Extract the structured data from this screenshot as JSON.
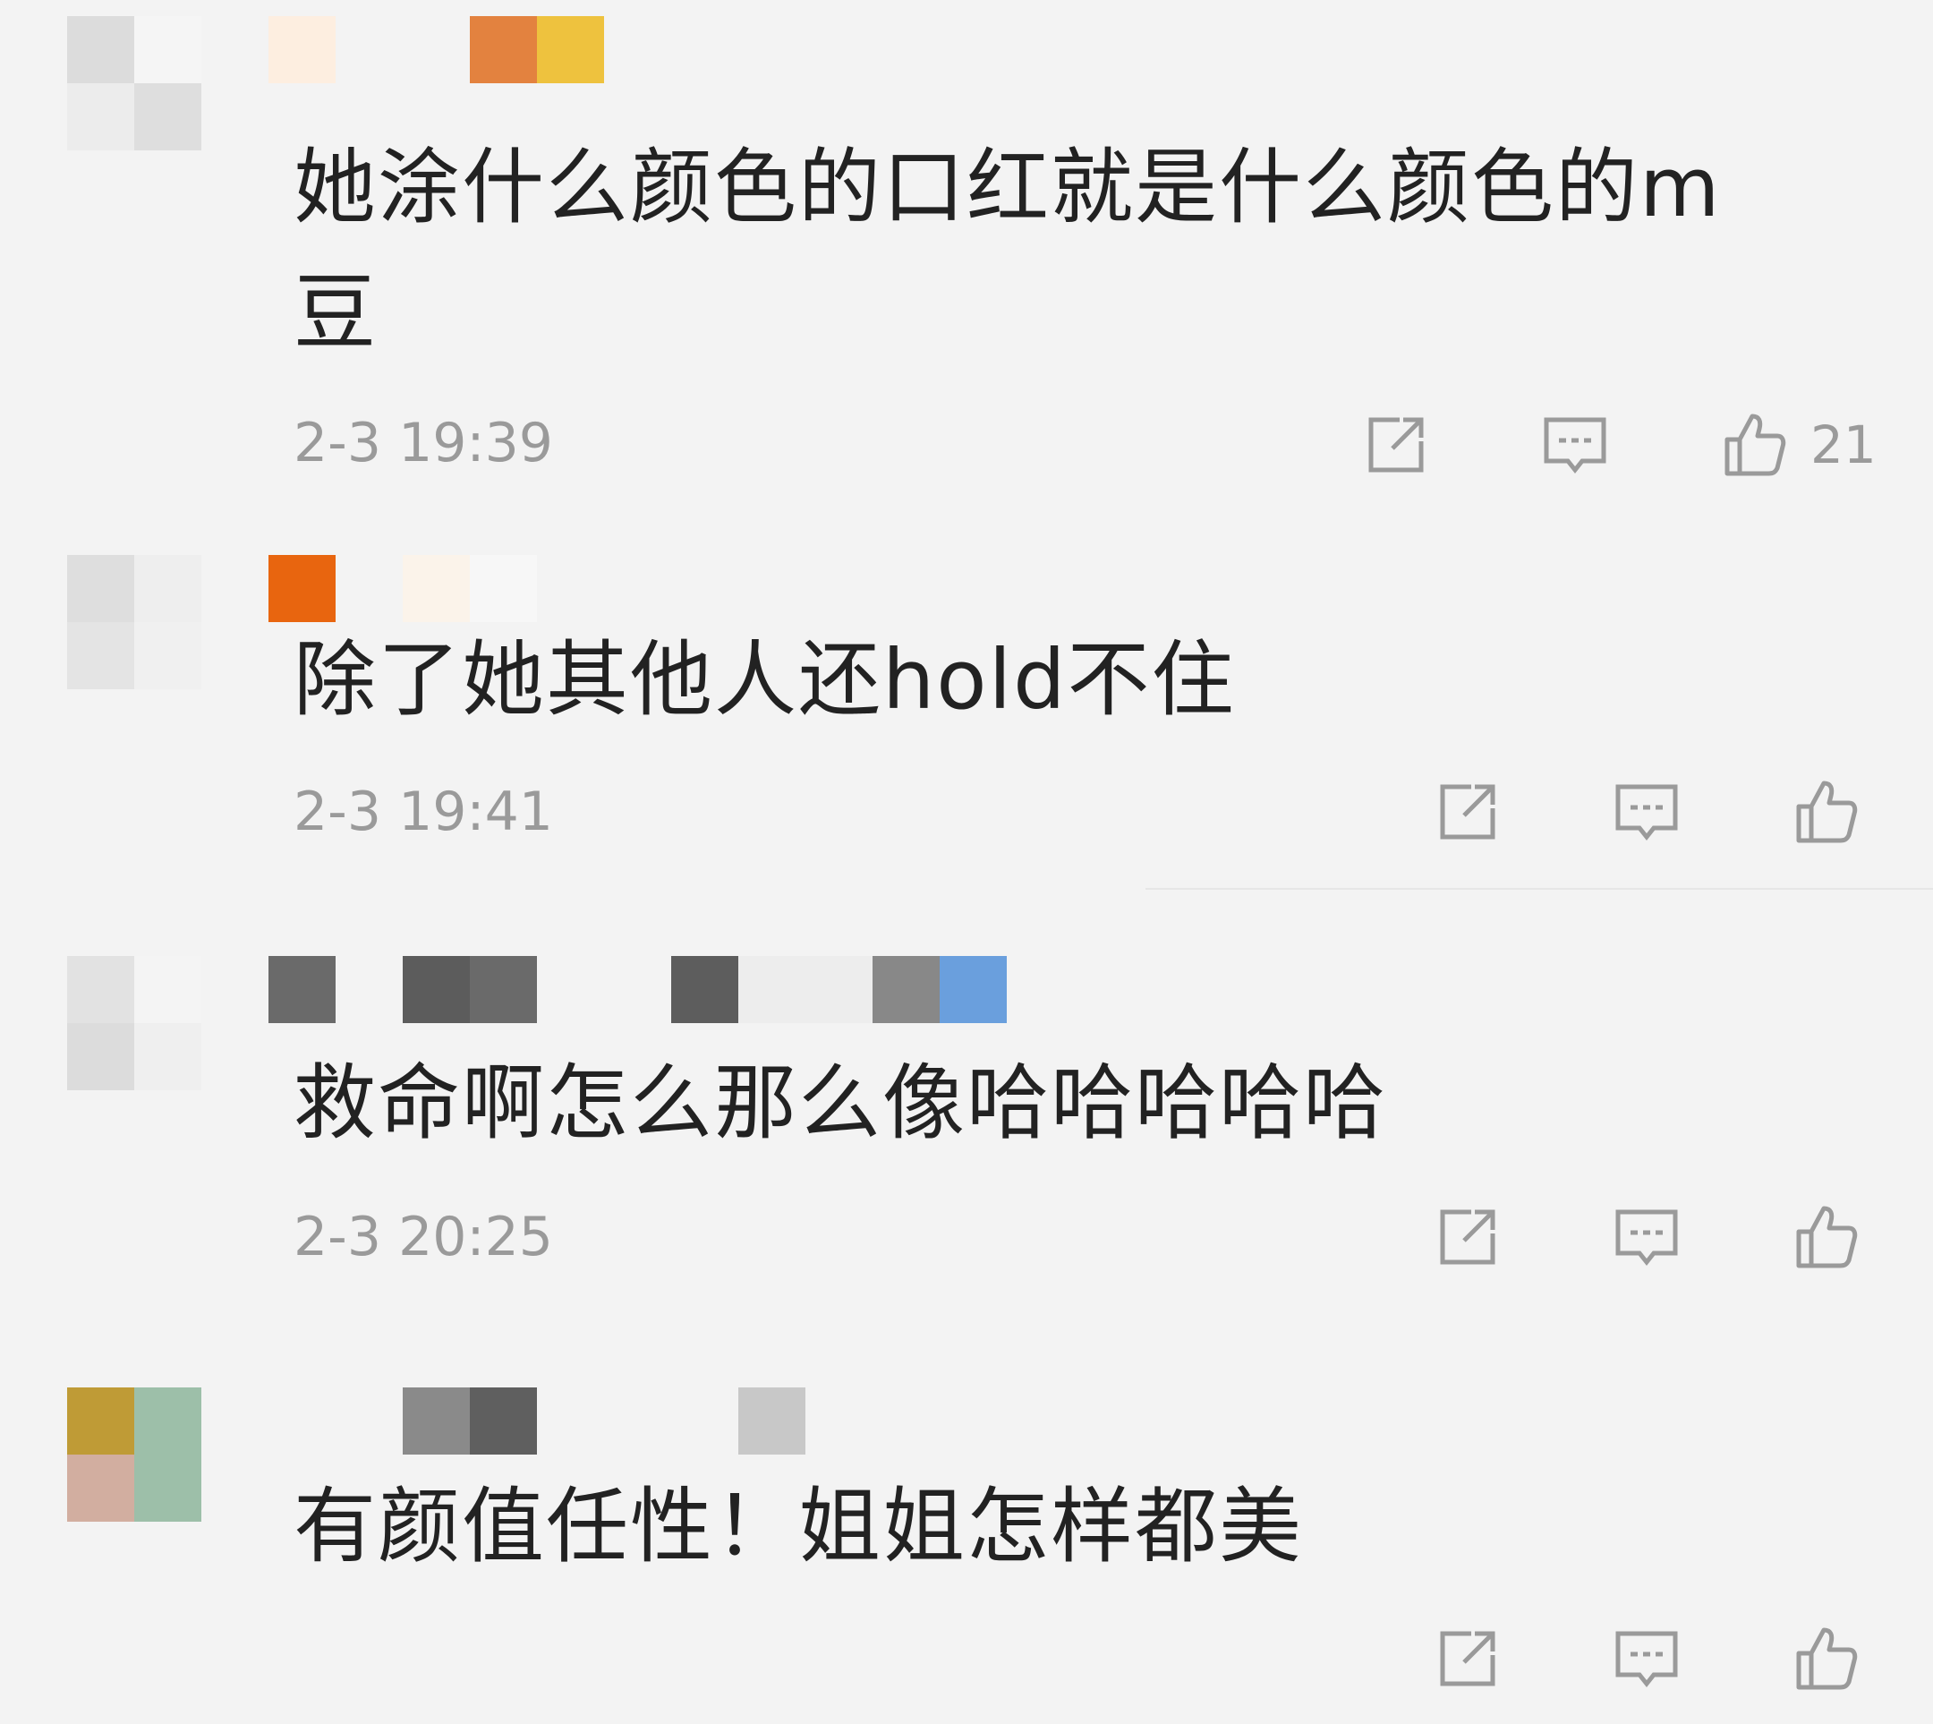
{
  "comments": [
    {
      "text": "她涂什么颜色的口红就是什么颜色的m\n豆",
      "time": "2-3 19:39",
      "likes": "21",
      "avatar_colors": [
        "#dcdcdc",
        "#f5f5f5",
        "#ececec",
        "#dedede"
      ],
      "username_colors": [
        "#fdeee0",
        "#f7f7f7",
        "#f4f4f4",
        "#e3823f",
        "#eec23e"
      ]
    },
    {
      "text": "除了她其他人还hold不住",
      "time": "2-3 19:41",
      "likes": "",
      "avatar_colors": [
        "#dedede",
        "#eeeeee",
        "#e4e4e4",
        "#f0f0f0"
      ],
      "username_colors": [
        "#e8650f",
        "#f3f3f3",
        "#fdeee3",
        "#fbf3ea",
        "#f7f7f7"
      ]
    },
    {
      "text": "救命啊怎么那么像哈哈哈哈哈",
      "time": "2-3 20:25",
      "likes": "",
      "avatar_colors": [
        "#e2e2e2",
        "#f4f4f4",
        "#dcdcdc",
        "#efefef"
      ],
      "username_colors": [
        "#6a6a6a",
        "#6a6a6a",
        "#5c5c5c",
        "#5d5d5d",
        "#888888",
        "#6a9fdd"
      ]
    },
    {
      "text": "有颜值任性！姐姐怎样都美",
      "time": "",
      "likes": "",
      "avatar_colors": [
        "#bf9b36",
        "#9dbfa9",
        "#d2aea0",
        "#9dbfa9"
      ],
      "username_colors": [
        "#8a8a8a",
        "#5f5f5f",
        "#c8c8c8"
      ]
    }
  ],
  "icons": {
    "share": "share-icon",
    "reply": "comment-icon",
    "like": "thumbs-up-icon"
  }
}
